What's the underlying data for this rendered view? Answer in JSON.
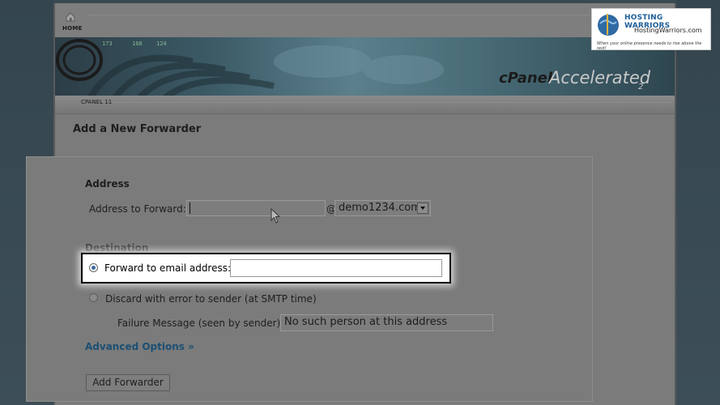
{
  "header": {
    "home_label": "HOME",
    "subnav_label": "CPANEL 11"
  },
  "banner": {
    "logo_text": "cPanel",
    "accelerated": "Accelerated",
    "version": "2"
  },
  "watermark": {
    "title": "HOSTING WARRIORS",
    "url": "HostingWarriors.com",
    "tagline": "When your online presence needs to rise above the rest!"
  },
  "page": {
    "title": "Add a New Forwarder"
  },
  "address": {
    "section_title": "Address",
    "label": "Address to Forward:",
    "value": "",
    "at_sign": "@",
    "domain": "demo1234.com"
  },
  "destination": {
    "section_title": "Destination",
    "forward_label": "Forward to email address:",
    "forward_value": "",
    "discard_label": "Discard with error to sender (at SMTP time)",
    "failure_label": "Failure Message (seen by sender):",
    "failure_value": "No such person at this address"
  },
  "advanced": {
    "label": "Advanced Options »"
  },
  "actions": {
    "submit_label": "Add Forwarder"
  }
}
